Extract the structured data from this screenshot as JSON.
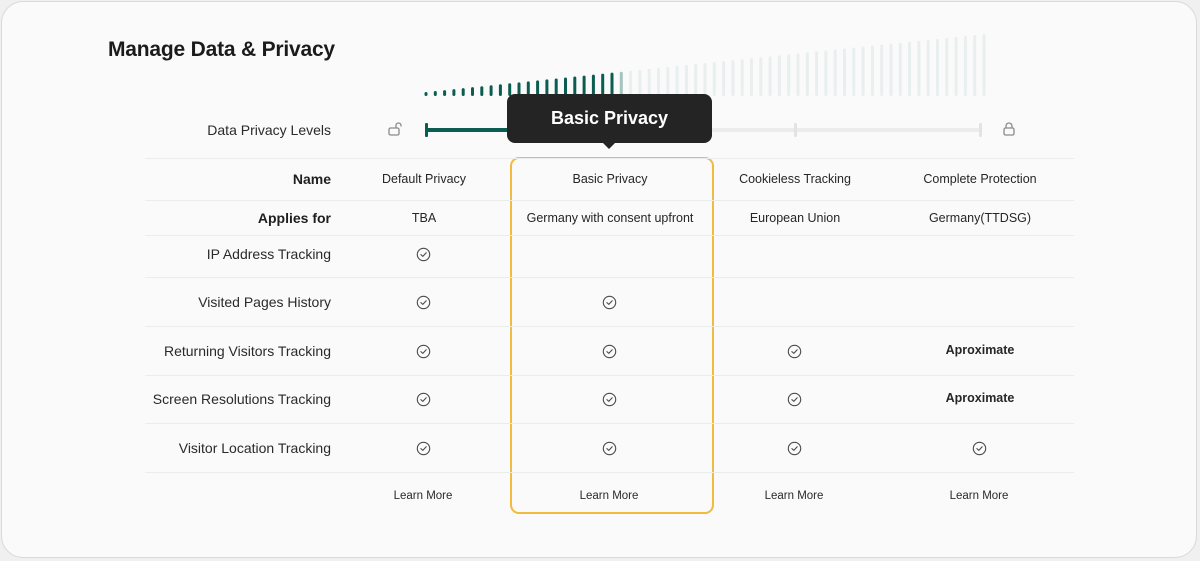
{
  "page": {
    "title": "Manage Data & Privacy",
    "levels_label": "Data Privacy Levels",
    "selected_level": "Basic Privacy",
    "slider": {
      "positions": 4,
      "selected_index": 1
    }
  },
  "colors": {
    "accent": "#0b5c51",
    "highlight_border": "#f0bb3e",
    "tooltip_bg": "#242424"
  },
  "icons": {
    "unlock": "unlock-icon",
    "lock": "lock-icon",
    "check": "check-circle-icon"
  },
  "columns": [
    "Default Privacy",
    "Basic Privacy",
    "Cookieless Tracking",
    "Complete Protection"
  ],
  "name_row_label": "Name",
  "applies_row": {
    "label": "Applies for",
    "values": [
      "TBA",
      "Germany with consent upfront",
      "European Union",
      "Germany(TTDSG)"
    ]
  },
  "features": [
    {
      "label": "IP Address Tracking",
      "values": [
        "check",
        "",
        "",
        ""
      ]
    },
    {
      "label": "Visited Pages History",
      "values": [
        "check",
        "check",
        "",
        ""
      ]
    },
    {
      "label": "Returning Visitors Tracking",
      "values": [
        "check",
        "check",
        "check",
        "Aproximate"
      ]
    },
    {
      "label": "Screen Resolutions Tracking",
      "values": [
        "check",
        "check",
        "check",
        "Aproximate"
      ]
    },
    {
      "label": "Visitor Location Tracking",
      "values": [
        "check",
        "check",
        "check",
        "check"
      ]
    }
  ],
  "learn_more_label": "Learn More"
}
